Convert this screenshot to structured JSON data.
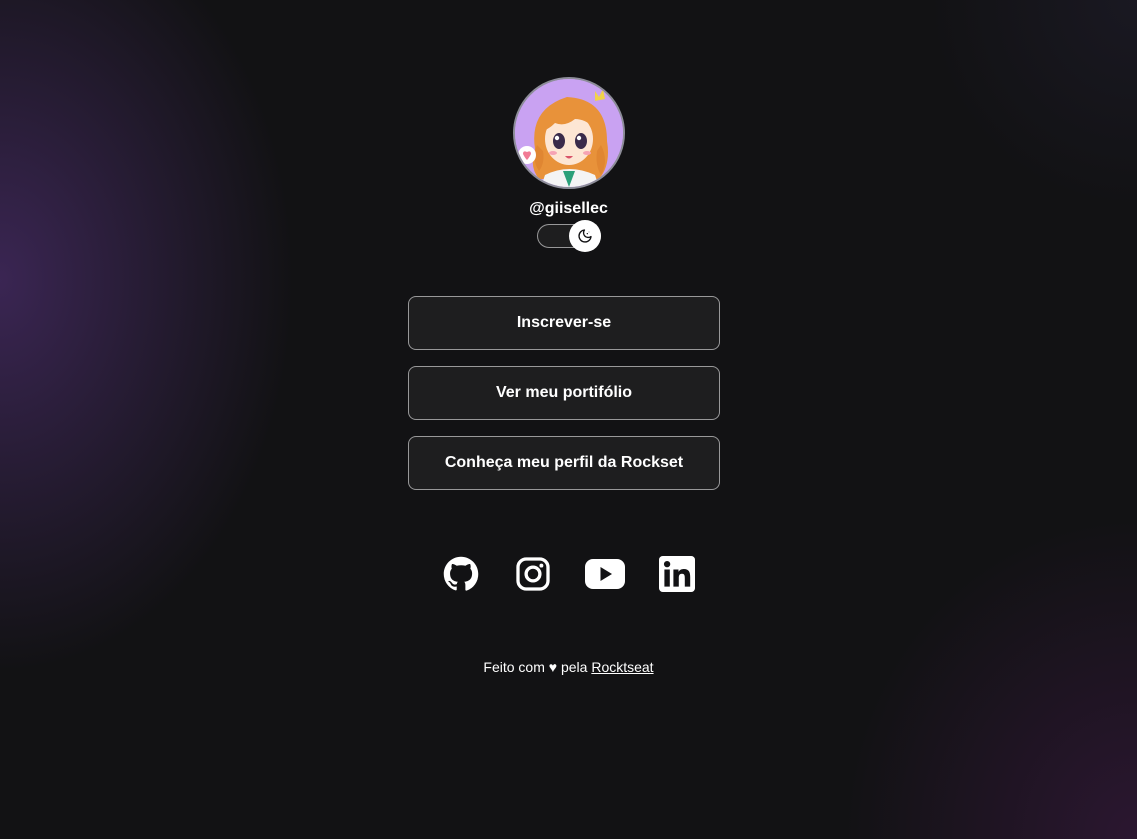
{
  "profile": {
    "username": "@giisellec",
    "avatar_icon": "anime-girl-avatar"
  },
  "theme_switch": {
    "icon": "moon-icon",
    "state": "dark"
  },
  "links": [
    {
      "label": "Inscrever-se"
    },
    {
      "label": "Ver meu portifólio"
    },
    {
      "label": "Conheça meu perfil da Rockset"
    }
  ],
  "social": [
    {
      "icon": "github-icon"
    },
    {
      "icon": "instagram-icon"
    },
    {
      "icon": "youtube-icon"
    },
    {
      "icon": "linkedin-icon"
    }
  ],
  "footer": {
    "text": "Feito com ♥ pela",
    "link_label": "Rocktseat"
  },
  "colors": {
    "background": "#121214",
    "text": "#ffffff",
    "accent_purple": "#482c68"
  }
}
